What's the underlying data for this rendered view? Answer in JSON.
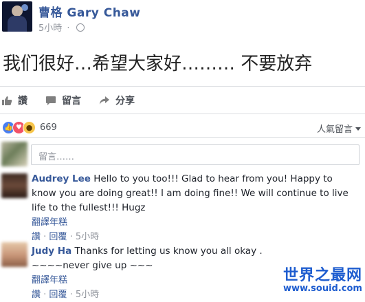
{
  "post": {
    "page_name": "曹格 Gary Chaw",
    "time": "5小時",
    "text": "我们很好…希望大家好……… 不要放弃"
  },
  "actions": {
    "like": "讚",
    "comment": "留言",
    "share": "分享"
  },
  "reactions": {
    "count": "669",
    "sort_label": "人氣留言"
  },
  "comment_input": {
    "placeholder": "留言……"
  },
  "comments": [
    {
      "author": "Audrey Lee",
      "text": "Hello to you too!!! Glad to hear from you! Happy to know you are doing great!! I am doing fine!! We will continue to live life to the fullest!!! Hugz",
      "translate": "翻譯年糕",
      "like": "讚",
      "reply": "回覆",
      "time": "5小時"
    },
    {
      "author": "Judy Ha",
      "text": "Thanks for letting us know you all okay .",
      "text2": "~~~~never give up ~~~",
      "translate": "翻譯年糕",
      "like": "讚",
      "reply": "回覆",
      "time": "5小時"
    }
  ],
  "watermark": {
    "title": "世界之最网",
    "url": "www.souid.com"
  },
  "colors": {
    "link": "#365899",
    "meta": "#90949c",
    "watermark": "#1d5ccf"
  }
}
